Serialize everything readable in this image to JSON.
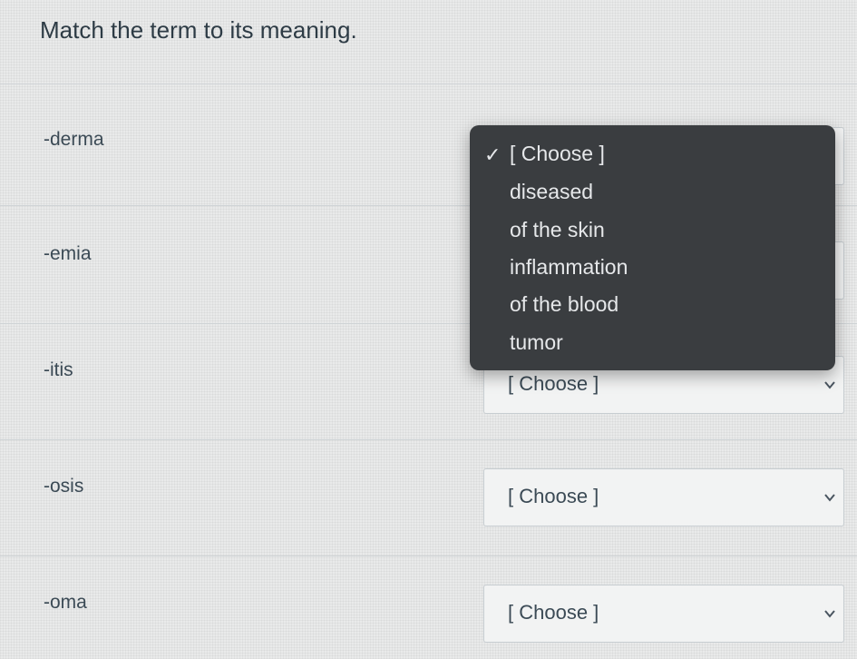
{
  "question": {
    "title": "Match the term to its meaning."
  },
  "terms": [
    {
      "label": "-derma",
      "selected": ""
    },
    {
      "label": "-emia",
      "selected": ""
    },
    {
      "label": "-itis",
      "selected": "[ Choose ]"
    },
    {
      "label": "-osis",
      "selected": "[ Choose ]"
    },
    {
      "label": "-oma",
      "selected": "[ Choose ]"
    }
  ],
  "dropdown": {
    "check": "✓",
    "options": [
      "[ Choose ]",
      "diseased",
      "of the skin",
      "inflammation",
      "of the blood",
      "tumor"
    ],
    "selected_index": 0
  },
  "colors": {
    "background": "#e9eaea",
    "dropdown_bg": "#3a3d40",
    "text": "#2d3b45"
  },
  "icons": {
    "select_arrow": "chevron-down-icon",
    "selected_mark": "checkmark-icon"
  }
}
